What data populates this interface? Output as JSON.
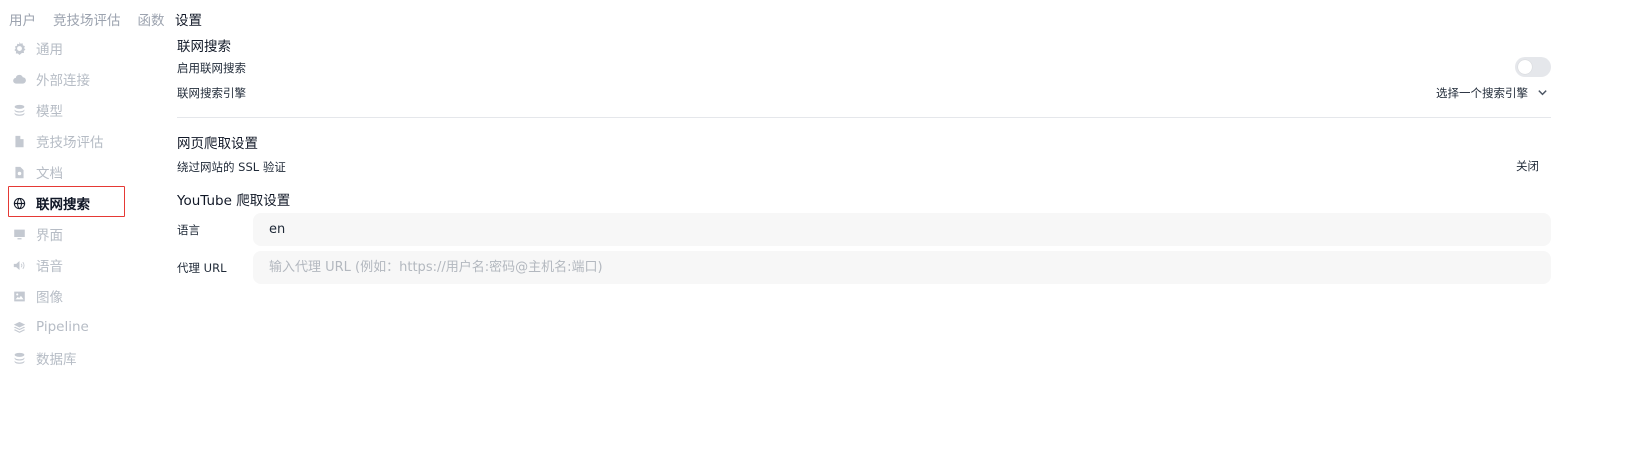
{
  "topnav": {
    "tabs": [
      {
        "label": "用户",
        "active": false
      },
      {
        "label": "竞技场评估",
        "active": false
      },
      {
        "label": "函数",
        "active": false
      },
      {
        "label": "设置",
        "active": true
      }
    ]
  },
  "sidebar": {
    "items": [
      {
        "label": "通用",
        "icon": "gear-icon"
      },
      {
        "label": "外部连接",
        "icon": "cloud-icon"
      },
      {
        "label": "模型",
        "icon": "stack-icon"
      },
      {
        "label": "竞技场评估",
        "icon": "document-icon"
      },
      {
        "label": "文档",
        "icon": "document-search-icon"
      },
      {
        "label": "联网搜索",
        "icon": "globe-icon",
        "active": true
      },
      {
        "label": "界面",
        "icon": "monitor-icon"
      },
      {
        "label": "语音",
        "icon": "speaker-icon"
      },
      {
        "label": "图像",
        "icon": "image-icon"
      },
      {
        "label": "Pipeline",
        "icon": "layers-icon"
      },
      {
        "label": "数据库",
        "icon": "database-icon"
      }
    ]
  },
  "web_search": {
    "section_title": "联网搜索",
    "enable_label": "启用联网搜索",
    "enabled": false,
    "engine_label": "联网搜索引擎",
    "engine_value": "选择一个搜索引擎"
  },
  "crawl": {
    "section_title": "网页爬取设置",
    "ssl_label": "绕过网站的 SSL 验证",
    "ssl_value": "关闭"
  },
  "youtube": {
    "section_title": "YouTube 爬取设置",
    "language_label": "语言",
    "language_value": "en",
    "proxy_label": "代理 URL",
    "proxy_value": "",
    "proxy_placeholder": "输入代理 URL (例如：https://用户名:密码@主机名:端口)"
  }
}
